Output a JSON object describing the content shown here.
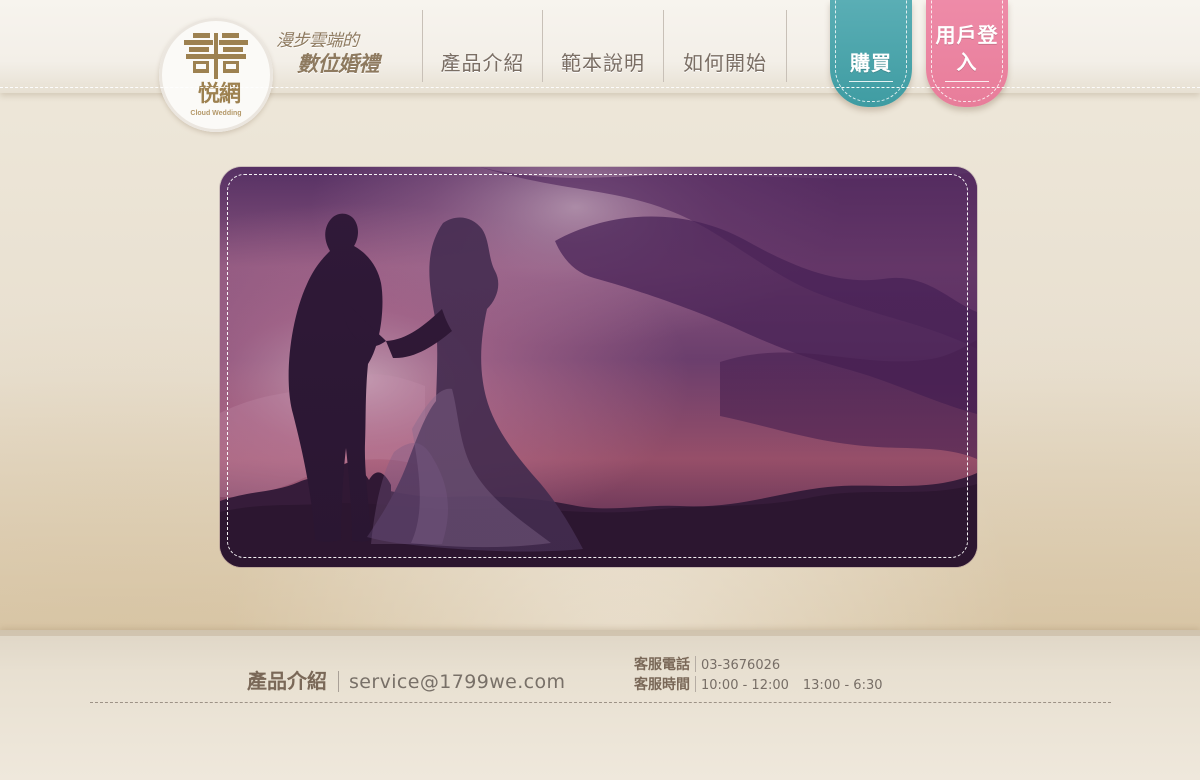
{
  "brand": {
    "logo_chars": "悦網",
    "logo_subtext": "Cloud Wedding",
    "tagline_top": "漫步雲端的",
    "tagline_bottom": "數位婚禮"
  },
  "navigation": {
    "items": [
      {
        "label": "產品介紹"
      },
      {
        "label": "範本說明"
      },
      {
        "label": "如何開始"
      }
    ]
  },
  "actions": {
    "buy_label": "購買",
    "login_label": "用戶登入",
    "buy_color": "#48a3aa",
    "login_color": "#ea819f"
  },
  "hero": {
    "image_name": "wedding-couple-sunset-image"
  },
  "footer": {
    "product_link": "產品介紹",
    "email": "service@1799we.com",
    "phone_label": "客服電話",
    "phone": "03-3676026",
    "hours_label": "客服時間",
    "hours_morning": "10:00 - 12:00",
    "hours_afternoon": "13:00 - 6:30"
  },
  "icons": {
    "logo": "double-happiness-icon"
  }
}
